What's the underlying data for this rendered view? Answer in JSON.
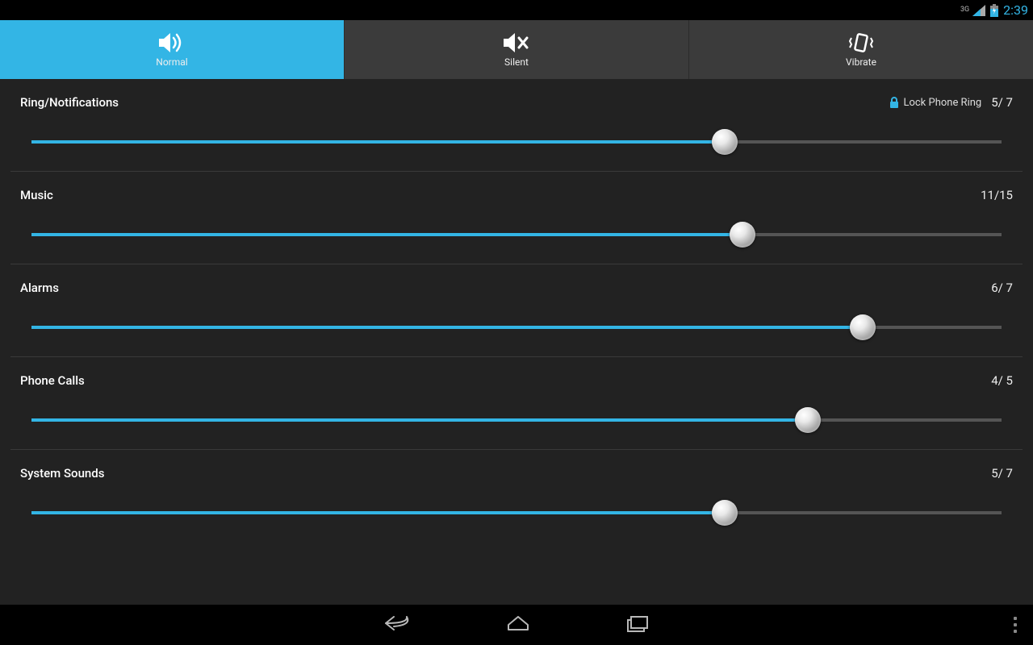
{
  "status": {
    "network": "3G",
    "time": "2:39"
  },
  "tabs": {
    "normal": "Normal",
    "silent": "Silent",
    "vibrate": "Vibrate"
  },
  "lock_label": "Lock Phone Ring",
  "rows": {
    "ring": {
      "title": "Ring/Notifications",
      "value": "5/ 7",
      "cur": 5,
      "max": 7,
      "lock": true
    },
    "music": {
      "title": "Music",
      "value": "11/15",
      "cur": 11,
      "max": 15,
      "lock": false
    },
    "alarms": {
      "title": "Alarms",
      "value": "6/ 7",
      "cur": 6,
      "max": 7,
      "lock": false
    },
    "calls": {
      "title": "Phone Calls",
      "value": "4/ 5",
      "cur": 4,
      "max": 5,
      "lock": false
    },
    "system": {
      "title": "System Sounds",
      "value": "5/ 7",
      "cur": 5,
      "max": 7,
      "lock": false
    }
  },
  "colors": {
    "accent": "#33b5e5"
  }
}
